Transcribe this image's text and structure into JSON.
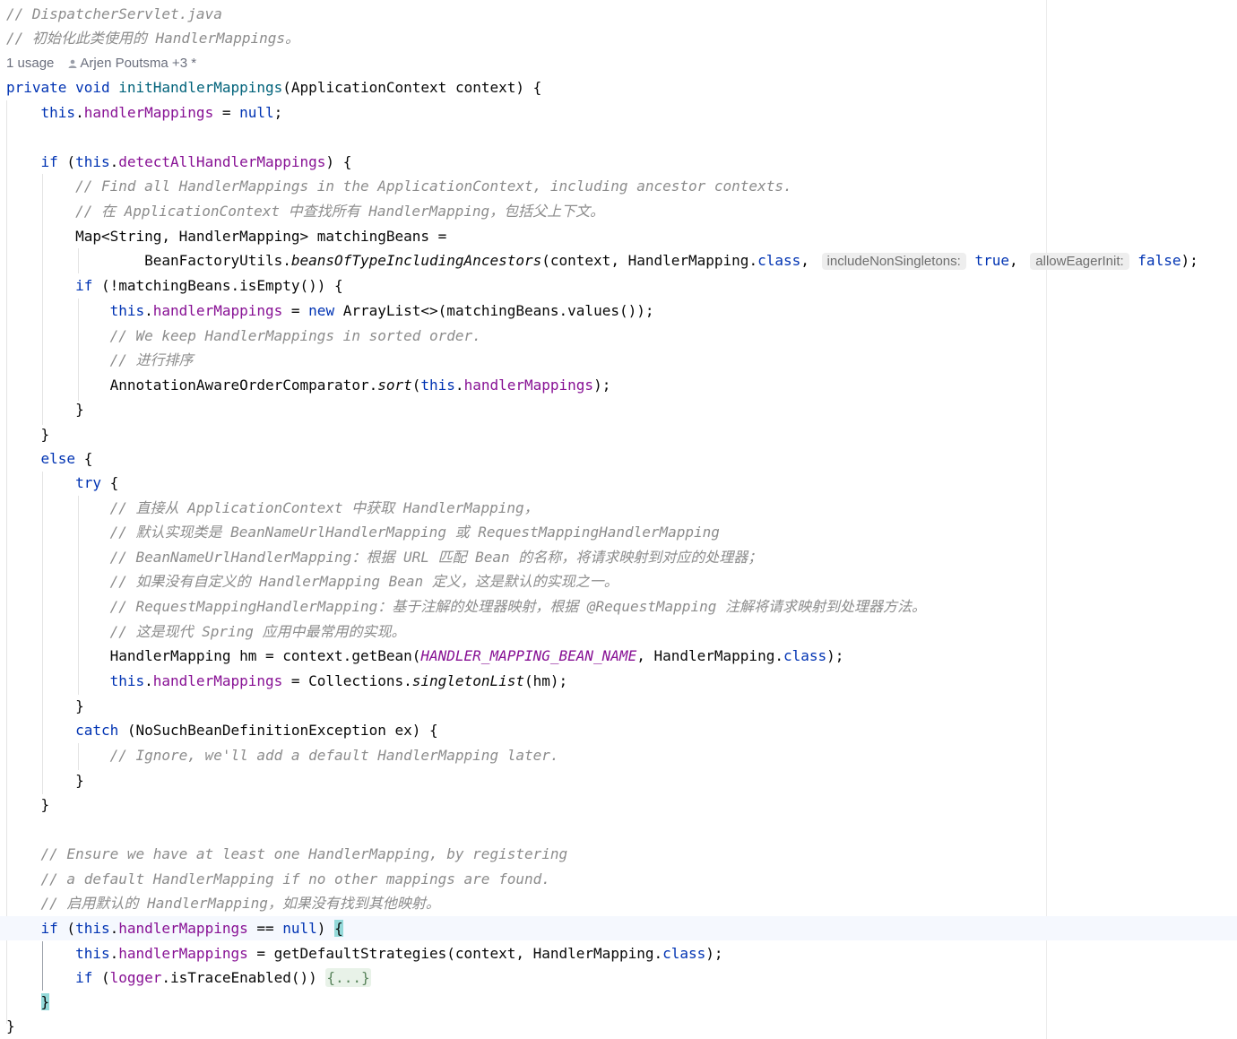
{
  "editor": {
    "header_comments": [
      "// DispatcherServlet.java",
      "// 初始化此类使用的 HandlerMappings。"
    ],
    "usage_hint": "1 usage",
    "author_hint": "Arjen Poutsma +3 *",
    "icons": {
      "author": "user-icon",
      "fold": "folded-code-block"
    },
    "colors": {
      "keyword": "#0033b3",
      "method": "#00627a",
      "field": "#871094",
      "comment": "#8c8c8c",
      "current_line": "#f5f8fe",
      "brace_match": "#93d9d9"
    },
    "code": {
      "sig_private": "private",
      "sig_void": "void",
      "sig_name": "initHandlerMappings",
      "sig_rest": "(ApplicationContext context) {",
      "this": "this",
      "dot": ".",
      "handlerMappings": "handlerMappings",
      "null": "null",
      "assign_null_rest": " = ",
      "semicolon": ";",
      "if": "if",
      "open_paren": " (",
      "detectAll": "detectAllHandlerMappings",
      "close_brace_open": ") {",
      "c1": "// Find all HandlerMappings in the ApplicationContext, including ancestor contexts.",
      "c2": "// 在 ApplicationContext 中查找所有 HandlerMapping，包括父上下文。",
      "map_decl": "Map<String, HandlerMapping> matchingBeans =",
      "bfu": "BeanFactoryUtils.",
      "beansOf": "beansOfTypeIncludingAncestors",
      "bfu_args": "(context, HandlerMapping.",
      "class": "class",
      "comma": ",",
      "hint1": "includeNonSingletons:",
      "true": "true",
      "hint2": "allowEagerInit:",
      "false": "false",
      "end_paren_semi": ");",
      "if_not_empty": " (!matchingBeans.isEmpty()) {",
      "new": "new",
      "arraylist": " ArrayList<>(matchingBeans.values());",
      "c3": "// We keep HandlerMappings in sorted order.",
      "c4": "// 进行排序",
      "aaoc": "AnnotationAwareOrderComparator.",
      "sort": "sort",
      "paren_open": "(",
      "close": "}",
      "else": "else",
      "try": "try",
      "brace_open": " {",
      "c5": "// 直接从 ApplicationContext 中获取 HandlerMapping，",
      "c6": "// 默认实现类是 BeanNameUrlHandlerMapping 或 RequestMappingHandlerMapping",
      "c7": "// BeanNameUrlHandlerMapping：根据 URL 匹配 Bean 的名称，将请求映射到对应的处理器；",
      "c8": "// 如果没有自定义的 HandlerMapping Bean 定义，这是默认的实现之一。",
      "c9": "// RequestMappingHandlerMapping：基于注解的处理器映射，根据 @RequestMapping 注解将请求映射到处理器方法。",
      "c10": "// 这是现代 Spring 应用中最常用的实现。",
      "hm_decl": "HandlerMapping hm = context.getBean(",
      "bean_name_const": "HANDLER_MAPPING_BEAN_NAME",
      "hm_rest": ", HandlerMapping.",
      "collections": " = Collections.",
      "singletonList": "singletonList",
      "hm_arg": "(hm);",
      "catch": "catch",
      "catch_rest": " (NoSuchBeanDefinitionException ex) {",
      "c11": "// Ignore, we'll add a default HandlerMapping later.",
      "c12": "// Ensure we have at least one HandlerMapping, by registering",
      "c13": "// a default HandlerMapping if no other mappings are found.",
      "c14": "// 启用默认的 HandlerMapping，如果没有找到其他映射。",
      "eq_null": " == ",
      "close_paren_sp": ") ",
      "open_brace": "{",
      "getDefault": " = getDefaultStrategies(context, HandlerMapping.",
      "logger": "logger",
      "trace": ".isTraceEnabled()) ",
      "folded": "{...}"
    }
  }
}
